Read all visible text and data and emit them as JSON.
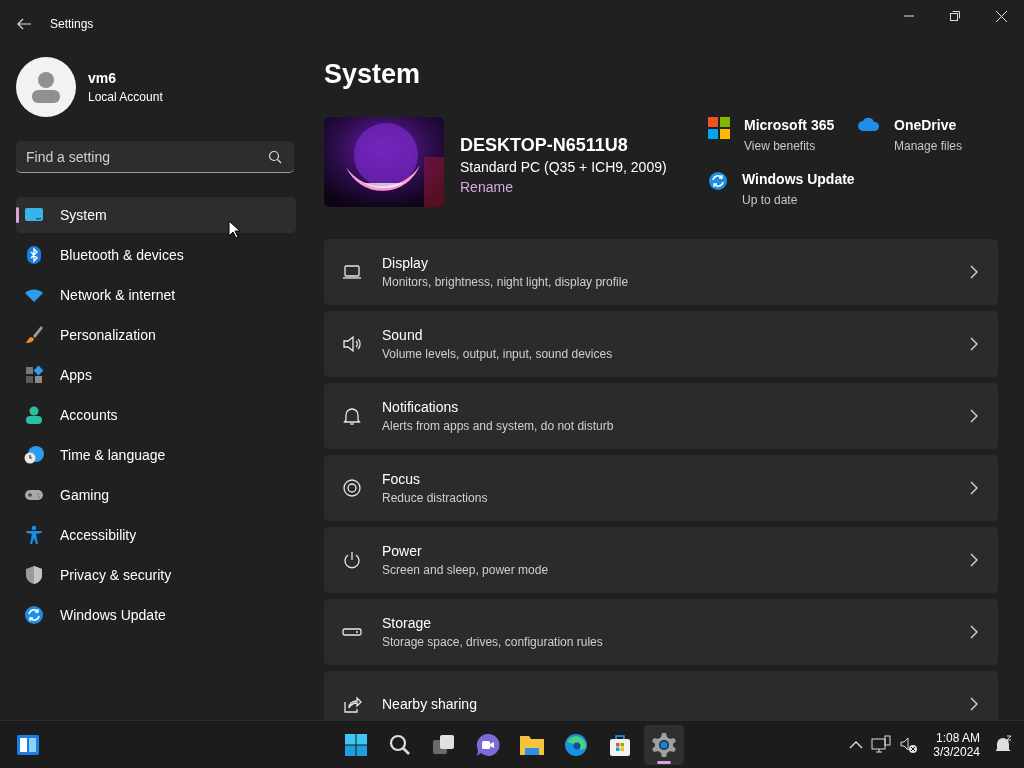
{
  "window": {
    "title": "Settings"
  },
  "user": {
    "name": "vm6",
    "account": "Local Account"
  },
  "search": {
    "placeholder": "Find a setting"
  },
  "nav": [
    {
      "label": "System",
      "kind": "system",
      "selected": true
    },
    {
      "label": "Bluetooth & devices",
      "kind": "bluetooth",
      "selected": false
    },
    {
      "label": "Network & internet",
      "kind": "network",
      "selected": false
    },
    {
      "label": "Personalization",
      "kind": "brush",
      "selected": false
    },
    {
      "label": "Apps",
      "kind": "apps",
      "selected": false
    },
    {
      "label": "Accounts",
      "kind": "accounts",
      "selected": false
    },
    {
      "label": "Time & language",
      "kind": "time",
      "selected": false
    },
    {
      "label": "Gaming",
      "kind": "gaming",
      "selected": false
    },
    {
      "label": "Accessibility",
      "kind": "accessibility",
      "selected": false
    },
    {
      "label": "Privacy & security",
      "kind": "privacy",
      "selected": false
    },
    {
      "label": "Windows Update",
      "kind": "update",
      "selected": false
    }
  ],
  "page_title": "System",
  "device": {
    "name": "DESKTOP-N6511U8",
    "model": "Standard PC (Q35 + ICH9, 2009)",
    "rename": "Rename"
  },
  "quick_links": [
    {
      "kind": "m365",
      "title": "Microsoft 365",
      "subtitle": "View benefits"
    },
    {
      "kind": "onedrive",
      "title": "OneDrive",
      "subtitle": "Manage files"
    },
    {
      "kind": "update",
      "title": "Windows Update",
      "subtitle": "Up to date"
    }
  ],
  "settings": [
    {
      "kind": "display",
      "title": "Display",
      "subtitle": "Monitors, brightness, night light, display profile"
    },
    {
      "kind": "sound",
      "title": "Sound",
      "subtitle": "Volume levels, output, input, sound devices"
    },
    {
      "kind": "notifications",
      "title": "Notifications",
      "subtitle": "Alerts from apps and system, do not disturb"
    },
    {
      "kind": "focus",
      "title": "Focus",
      "subtitle": "Reduce distractions"
    },
    {
      "kind": "power",
      "title": "Power",
      "subtitle": "Screen and sleep, power mode"
    },
    {
      "kind": "storage",
      "title": "Storage",
      "subtitle": "Storage space, drives, configuration rules"
    },
    {
      "kind": "share",
      "title": "Nearby sharing"
    }
  ],
  "taskbar": {
    "apps": [
      {
        "kind": "start",
        "selected": false
      },
      {
        "kind": "search",
        "selected": false
      },
      {
        "kind": "taskview",
        "selected": false
      },
      {
        "kind": "chat",
        "selected": false
      },
      {
        "kind": "explorer",
        "selected": false
      },
      {
        "kind": "edge",
        "selected": false
      },
      {
        "kind": "store",
        "selected": false
      },
      {
        "kind": "settings",
        "selected": true
      }
    ],
    "time": "1:08 AM",
    "date": "3/3/2024"
  }
}
